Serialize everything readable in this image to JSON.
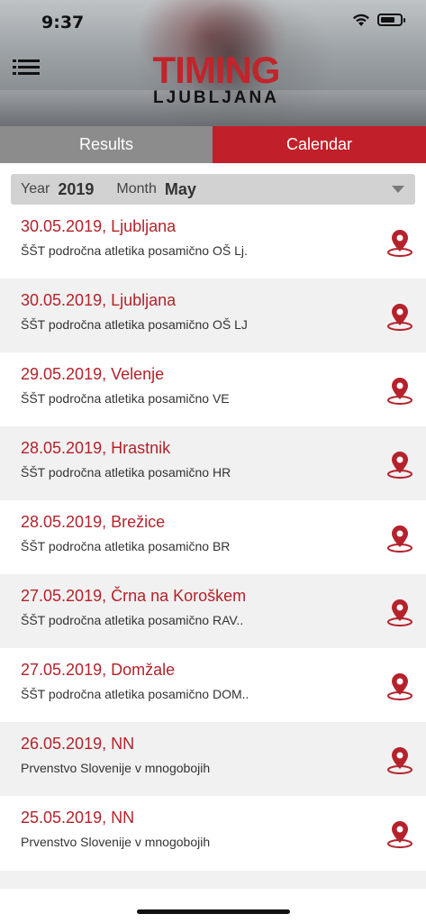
{
  "status": {
    "time": "9:37"
  },
  "logo": {
    "main": "TIMING",
    "sub": "LJUBLJANA"
  },
  "tabs": [
    {
      "label": "Results",
      "active": false
    },
    {
      "label": "Calendar",
      "active": true
    }
  ],
  "filter": {
    "year_label": "Year",
    "year_value": "2019",
    "month_label": "Month",
    "month_value": "May"
  },
  "colors": {
    "accent": "#c1202a",
    "tab_inactive": "#8c8c8c"
  },
  "events": [
    {
      "title": "30.05.2019, Ljubljana",
      "subtitle": "ŠŠT področna atletika posamično OŠ  Lj."
    },
    {
      "title": "30.05.2019, Ljubljana",
      "subtitle": "ŠŠT področna atletika posamično OŠ LJ"
    },
    {
      "title": "29.05.2019, Velenje",
      "subtitle": "ŠŠT področna atletika posamično VE"
    },
    {
      "title": "28.05.2019, Hrastnik",
      "subtitle": "ŠŠT področna atletika posamično HR"
    },
    {
      "title": "28.05.2019, Brežice",
      "subtitle": "ŠŠT področna atletika posamično BR"
    },
    {
      "title": "27.05.2019, Črna na Koroškem",
      "subtitle": "ŠŠT področna atletika posamično RAV.."
    },
    {
      "title": "27.05.2019, Domžale",
      "subtitle": "ŠŠT področna atletika posamično DOM.."
    },
    {
      "title": "26.05.2019, NN",
      "subtitle": "Prvenstvo Slovenije v mnogobojih"
    },
    {
      "title": "25.05.2019, NN",
      "subtitle": "Prvenstvo Slovenije v mnogobojih"
    }
  ]
}
